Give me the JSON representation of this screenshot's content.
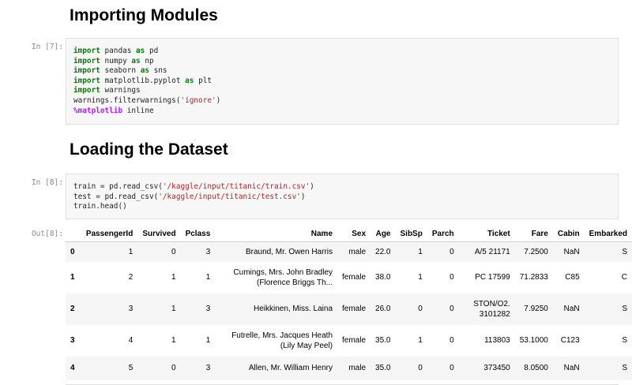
{
  "headings": {
    "importing": "Importing Modules",
    "loading": "Loading the Dataset"
  },
  "cells": {
    "import_prompt": "In [7]:",
    "load_prompt": "In [8]:",
    "output_prompt": "Out[8]:"
  },
  "code_cell_7": [
    {
      "kw": "import",
      "rest_a": " pandas ",
      "kw2": "as",
      "rest_b": " pd"
    },
    {
      "kw": "import",
      "rest_a": " numpy ",
      "kw2": "as",
      "rest_b": " np"
    },
    {
      "kw": "import",
      "rest_a": " seaborn ",
      "kw2": "as",
      "rest_b": " sns"
    },
    {
      "kw": "import",
      "rest_a": " matplotlib.pyplot ",
      "kw2": "as",
      "rest_b": " plt"
    },
    {
      "kw": "import",
      "rest_a": " warnings",
      "kw2": "",
      "rest_b": ""
    }
  ],
  "code_cell_7_tail": {
    "filter_pre": "warnings.filterwarnings(",
    "filter_str": "'ignore'",
    "filter_post": ")",
    "magic": "%matplotlib",
    "magic_rest": " inline"
  },
  "code_cell_8": {
    "train_pre": "train = pd.read_csv(",
    "train_str": "'/kaggle/input/titanic/train.csv'",
    "train_post": ")",
    "test_pre": "test = pd.read_csv(",
    "test_str": "'/kaggle/input/titanic/test.csv'",
    "test_post": ")",
    "head": "train.head()"
  },
  "dataframe": {
    "columns": [
      "",
      "PassengerId",
      "Survived",
      "Pclass",
      "Name",
      "Sex",
      "Age",
      "SibSp",
      "Parch",
      "Ticket",
      "Fare",
      "Cabin",
      "Embarked"
    ],
    "rows": [
      {
        "idx": "0",
        "PassengerId": "1",
        "Survived": "0",
        "Pclass": "3",
        "Name1": "Braund, Mr. Owen Harris",
        "Name2": "",
        "Sex": "male",
        "Age": "22.0",
        "SibSp": "1",
        "Parch": "0",
        "Ticket1": "A/5 21171",
        "Ticket2": "",
        "Fare": "7.2500",
        "Cabin": "NaN",
        "Embarked": "S"
      },
      {
        "idx": "1",
        "PassengerId": "2",
        "Survived": "1",
        "Pclass": "1",
        "Name1": "Cumings, Mrs. John Bradley",
        "Name2": "(Florence Briggs Th...",
        "Sex": "female",
        "Age": "38.0",
        "SibSp": "1",
        "Parch": "0",
        "Ticket1": "PC 17599",
        "Ticket2": "",
        "Fare": "71.2833",
        "Cabin": "C85",
        "Embarked": "C"
      },
      {
        "idx": "2",
        "PassengerId": "3",
        "Survived": "1",
        "Pclass": "3",
        "Name1": "Heikkinen, Miss. Laina",
        "Name2": "",
        "Sex": "female",
        "Age": "26.0",
        "SibSp": "0",
        "Parch": "0",
        "Ticket1": "STON/O2.",
        "Ticket2": "3101282",
        "Fare": "7.9250",
        "Cabin": "NaN",
        "Embarked": "S"
      },
      {
        "idx": "3",
        "PassengerId": "4",
        "Survived": "1",
        "Pclass": "1",
        "Name1": "Futrelle, Mrs. Jacques Heath",
        "Name2": "(Lily May Peel)",
        "Sex": "female",
        "Age": "35.0",
        "SibSp": "1",
        "Parch": "0",
        "Ticket1": "113803",
        "Ticket2": "",
        "Fare": "53.1000",
        "Cabin": "C123",
        "Embarked": "S"
      },
      {
        "idx": "4",
        "PassengerId": "5",
        "Survived": "0",
        "Pclass": "3",
        "Name1": "Allen, Mr. William Henry",
        "Name2": "",
        "Sex": "male",
        "Age": "35.0",
        "SibSp": "0",
        "Parch": "0",
        "Ticket1": "373450",
        "Ticket2": "",
        "Fare": "8.0500",
        "Cabin": "NaN",
        "Embarked": "S"
      }
    ]
  },
  "colors": {
    "keyword": "#008000",
    "string": "#ba2121",
    "magic": "#aa22ff",
    "cell_bg": "#f7f7f7",
    "prompt": "#8a8a8a"
  }
}
